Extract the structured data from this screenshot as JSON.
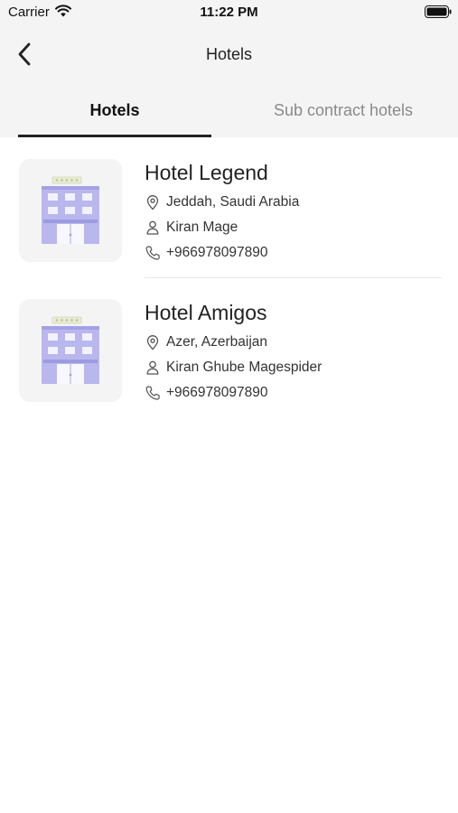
{
  "status_bar": {
    "carrier": "Carrier",
    "time": "11:22 PM"
  },
  "nav": {
    "title": "Hotels",
    "back_icon": "chevron-left-icon"
  },
  "tabs": [
    {
      "label": "Hotels",
      "active": true
    },
    {
      "label": "Sub contract hotels",
      "active": false
    }
  ],
  "hotels": [
    {
      "name": "Hotel Legend",
      "location": "Jeddah, Saudi Arabia",
      "contact": "Kiran Mage",
      "phone": "+966978097890"
    },
    {
      "name": "Hotel Amigos",
      "location": "Azer, Azerbaijan",
      "contact": "Kiran Ghube Magespider",
      "phone": "+966978097890"
    }
  ],
  "colors": {
    "header_bg": "#f4f4f4",
    "building": "#b7b5ee",
    "active_tab": "#222222",
    "inactive_tab": "#8a8a8a"
  }
}
